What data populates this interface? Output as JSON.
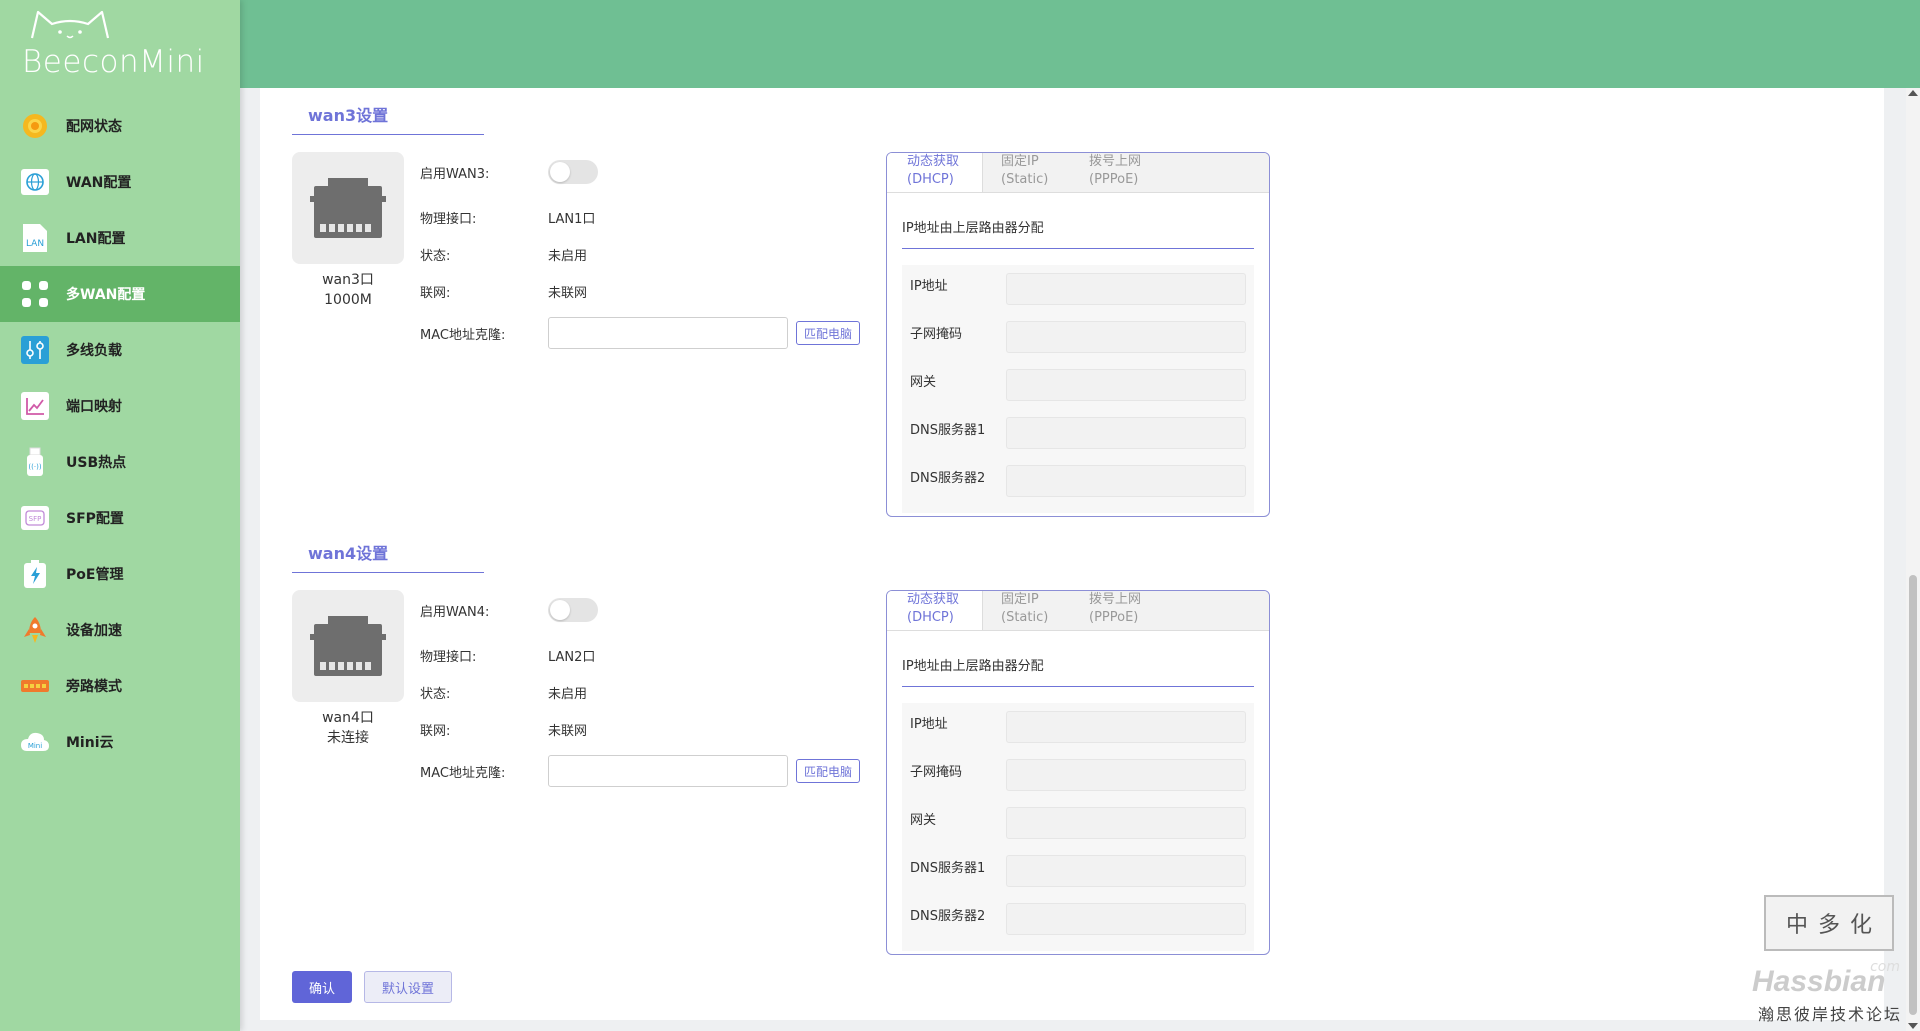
{
  "brand": {
    "name": "BeeconMini"
  },
  "sidebar": {
    "items": [
      {
        "label": "配网状态",
        "icon": "sun-status-icon",
        "active": false
      },
      {
        "label": "WAN配置",
        "icon": "globe-icon",
        "active": false
      },
      {
        "label": "LAN配置",
        "icon": "lan-icon",
        "active": false
      },
      {
        "label": "多WAN配置",
        "icon": "grid-dots-icon",
        "active": true
      },
      {
        "label": "多线负载",
        "icon": "sliders-icon",
        "active": false
      },
      {
        "label": "端口映射",
        "icon": "chart-icon",
        "active": false
      },
      {
        "label": "USB热点",
        "icon": "usb-icon",
        "active": false
      },
      {
        "label": "SFP配置",
        "icon": "sfp-icon",
        "active": false
      },
      {
        "label": "PoE管理",
        "icon": "battery-bolt-icon",
        "active": false
      },
      {
        "label": "设备加速",
        "icon": "rocket-icon",
        "active": false
      },
      {
        "label": "旁路模式",
        "icon": "bypass-icon",
        "active": false
      },
      {
        "label": "Mini云",
        "icon": "cloud-icon",
        "active": false
      }
    ]
  },
  "wan3": {
    "title": "wan3设置",
    "port_name": "wan3口",
    "port_status": "1000M",
    "enable_label": "启用WAN3:",
    "interface_label": "物理接口:",
    "interface_value": "LAN1口",
    "state_label": "状态:",
    "state_value": "未启用",
    "network_label": "联网:",
    "network_value": "未联网",
    "mac_label": "MAC地址克隆:",
    "mac_value": "",
    "match_button": "匹配电脑",
    "tabs": [
      {
        "line1": "动态获取",
        "line2": "(DHCP)"
      },
      {
        "line1": "固定IP",
        "line2": "(Static)"
      },
      {
        "line1": "拨号上网",
        "line2": "(PPPoE)"
      }
    ],
    "desc": "IP地址由上层路由器分配",
    "fields": [
      "IP地址",
      "子网掩码",
      "网关",
      "DNS服务器1",
      "DNS服务器2"
    ]
  },
  "wan4": {
    "title": "wan4设置",
    "port_name": "wan4口",
    "port_status": "未连接",
    "enable_label": "启用WAN4:",
    "interface_label": "物理接口:",
    "interface_value": "LAN2口",
    "state_label": "状态:",
    "state_value": "未启用",
    "network_label": "联网:",
    "network_value": "未联网",
    "mac_label": "MAC地址克隆:",
    "mac_value": "",
    "match_button": "匹配电脑",
    "tabs": [
      {
        "line1": "动态获取",
        "line2": "(DHCP)"
      },
      {
        "line1": "固定IP",
        "line2": "(Static)"
      },
      {
        "line1": "拨号上网",
        "line2": "(PPPoE)"
      }
    ],
    "desc": "IP地址由上层路由器分配",
    "fields": [
      "IP地址",
      "子网掩码",
      "网关",
      "DNS服务器1",
      "DNS服务器2"
    ]
  },
  "actions": {
    "confirm": "确认",
    "default": "默认设置"
  },
  "watermark": {
    "text": "Hassbian",
    "com": "com",
    "cn": "瀚思彼岸技术论坛",
    "seal": [
      "中",
      "多",
      "化"
    ]
  },
  "colors": {
    "sidebar": "#a0d8a2",
    "sidebar_active": "#63b468",
    "topbar": "#6fbf93",
    "accent": "#6f74d8"
  }
}
